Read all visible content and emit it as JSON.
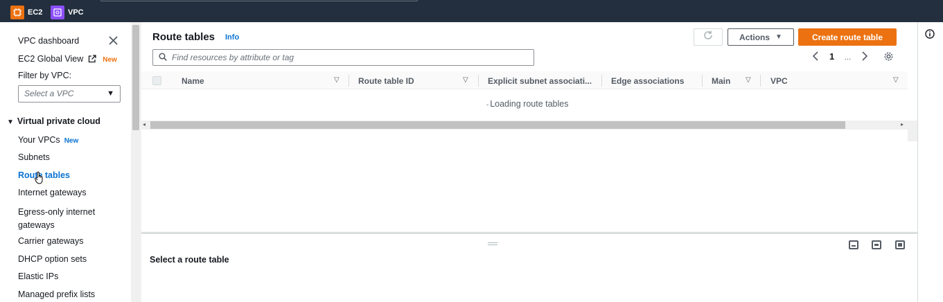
{
  "topbar": {
    "services": [
      {
        "label": "EC2",
        "icon": "ec2-icon",
        "color": "#ec7211"
      },
      {
        "label": "VPC",
        "icon": "vpc-icon",
        "color": "#8c4fff"
      }
    ]
  },
  "sidebar": {
    "dashboard": "VPC dashboard",
    "ec2_global_view": "EC2 Global View",
    "ec2_global_view_badge": "New",
    "filter_label": "Filter by VPC:",
    "filter_placeholder": "Select a VPC",
    "section_title": "Virtual private cloud",
    "items": [
      {
        "label": "Your VPCs",
        "badge": "New"
      },
      {
        "label": "Subnets"
      },
      {
        "label": "Route tables",
        "active": true
      },
      {
        "label": "Internet gateways"
      },
      {
        "label": "Egress-only internet gateways"
      },
      {
        "label": "Carrier gateways"
      },
      {
        "label": "DHCP option sets"
      },
      {
        "label": "Elastic IPs"
      },
      {
        "label": "Managed prefix lists"
      }
    ]
  },
  "main": {
    "title": "Route tables",
    "info": "Info",
    "actions_label": "Actions",
    "create_label": "Create route table",
    "search_placeholder": "Find resources by attribute or tag",
    "pager": {
      "page": "1",
      "ellipsis": "..."
    },
    "columns": [
      "Name",
      "Route table ID",
      "Explicit subnet associati...",
      "Edge associations",
      "Main",
      "VPC"
    ],
    "loading": "Loading route tables"
  },
  "lower": {
    "title": "Select a route table"
  },
  "colors": {
    "topbar": "#232f3e",
    "primary": "#ec7211",
    "link": "#0972d3"
  }
}
